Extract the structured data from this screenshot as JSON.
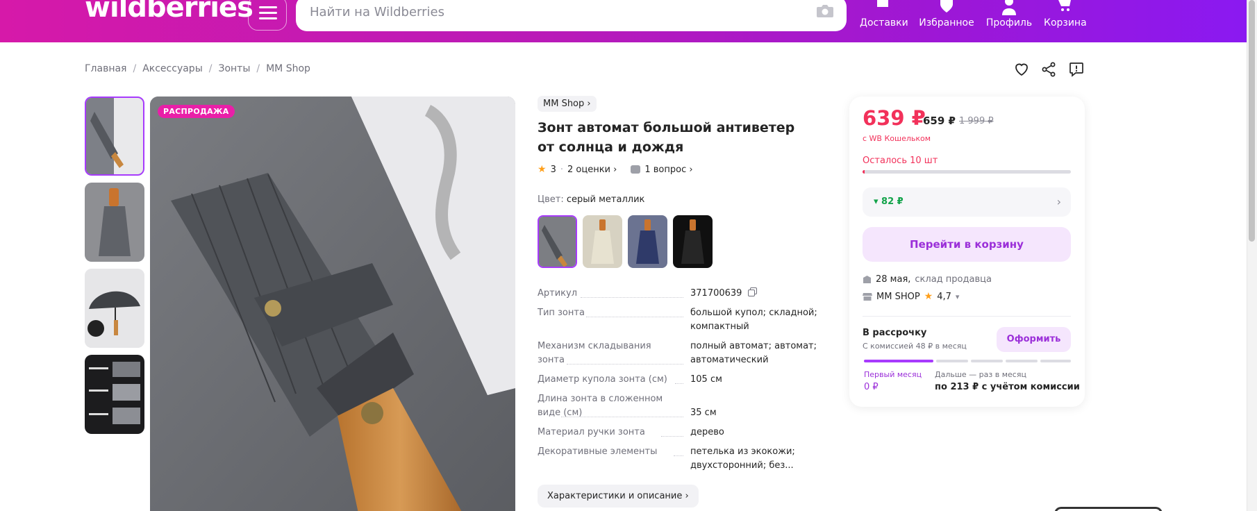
{
  "header": {
    "logo": "wildberries",
    "search_placeholder": "Найти на Wildberries",
    "nav": [
      {
        "label": "Доставки",
        "icon": "box-icon"
      },
      {
        "label": "Избранное",
        "icon": "heart-icon"
      },
      {
        "label": "Профиль",
        "icon": "user-icon"
      },
      {
        "label": "Корзина",
        "icon": "cart-icon"
      }
    ]
  },
  "breadcrumb": [
    "Главная",
    "Аксессуары",
    "Зонты",
    "MM Shop"
  ],
  "gallery": {
    "sale_badge": "РАСПРОДАЖА",
    "thumbnails": [
      "thumb-1",
      "thumb-2",
      "thumb-3",
      "thumb-4"
    ]
  },
  "product": {
    "brand": "MM Shop",
    "title": "Зонт автомат большой антиветер от солнца и дождя",
    "rating": "3",
    "reviews": "2 оценки",
    "questions": "1 вопрос",
    "color_label": "Цвет:",
    "color_value": "серый металлик",
    "specs": [
      {
        "k": "Артикул",
        "v": "371700639"
      },
      {
        "k": "Тип зонта",
        "v": "большой купол; складной; компактный"
      },
      {
        "k": "Механизм складывания зонта",
        "v": "полный автомат; автомат; автоматический"
      },
      {
        "k": "Диаметр купола зонта (см)",
        "v": "105 см"
      },
      {
        "k": "Длина зонта в сложенном виде (см)",
        "v": "35 см"
      },
      {
        "k": "Материал ручки зонта",
        "v": "дерево"
      },
      {
        "k": "Декоративные элементы",
        "v": "петелька из экокожи; двухсторонний; без..."
      }
    ],
    "chars_button": "Характеристики и описание"
  },
  "card": {
    "price": "639 ₽",
    "price_second": "659 ₽",
    "price_old": "1 999 ₽",
    "wallet_note": "с WB Кошельком",
    "remaining": "Осталось 10 шт",
    "remaining_fraction": 0.01,
    "discount": "▾ 82 ₽",
    "cart_button": "Перейти в корзину",
    "delivery_date": "28 мая,",
    "delivery_source": "склад продавца",
    "seller": "MM SHOP",
    "seller_rating": "4,7",
    "installment_title": "В рассрочку",
    "installment_sub": "С комиссией 48 ₽ в месяц",
    "installment_button": "Оформить",
    "first_month_label": "Первый месяц",
    "first_month_value": "0 ₽",
    "next_label": "Дальше — раз в месяц",
    "next_value": "по 213 ₽ с учётом комиссии"
  },
  "colors": {
    "accent": "#a73afd",
    "price_red": "#f2315a",
    "sale_pink": "#e91fa8",
    "discount_green": "#13a34a"
  }
}
